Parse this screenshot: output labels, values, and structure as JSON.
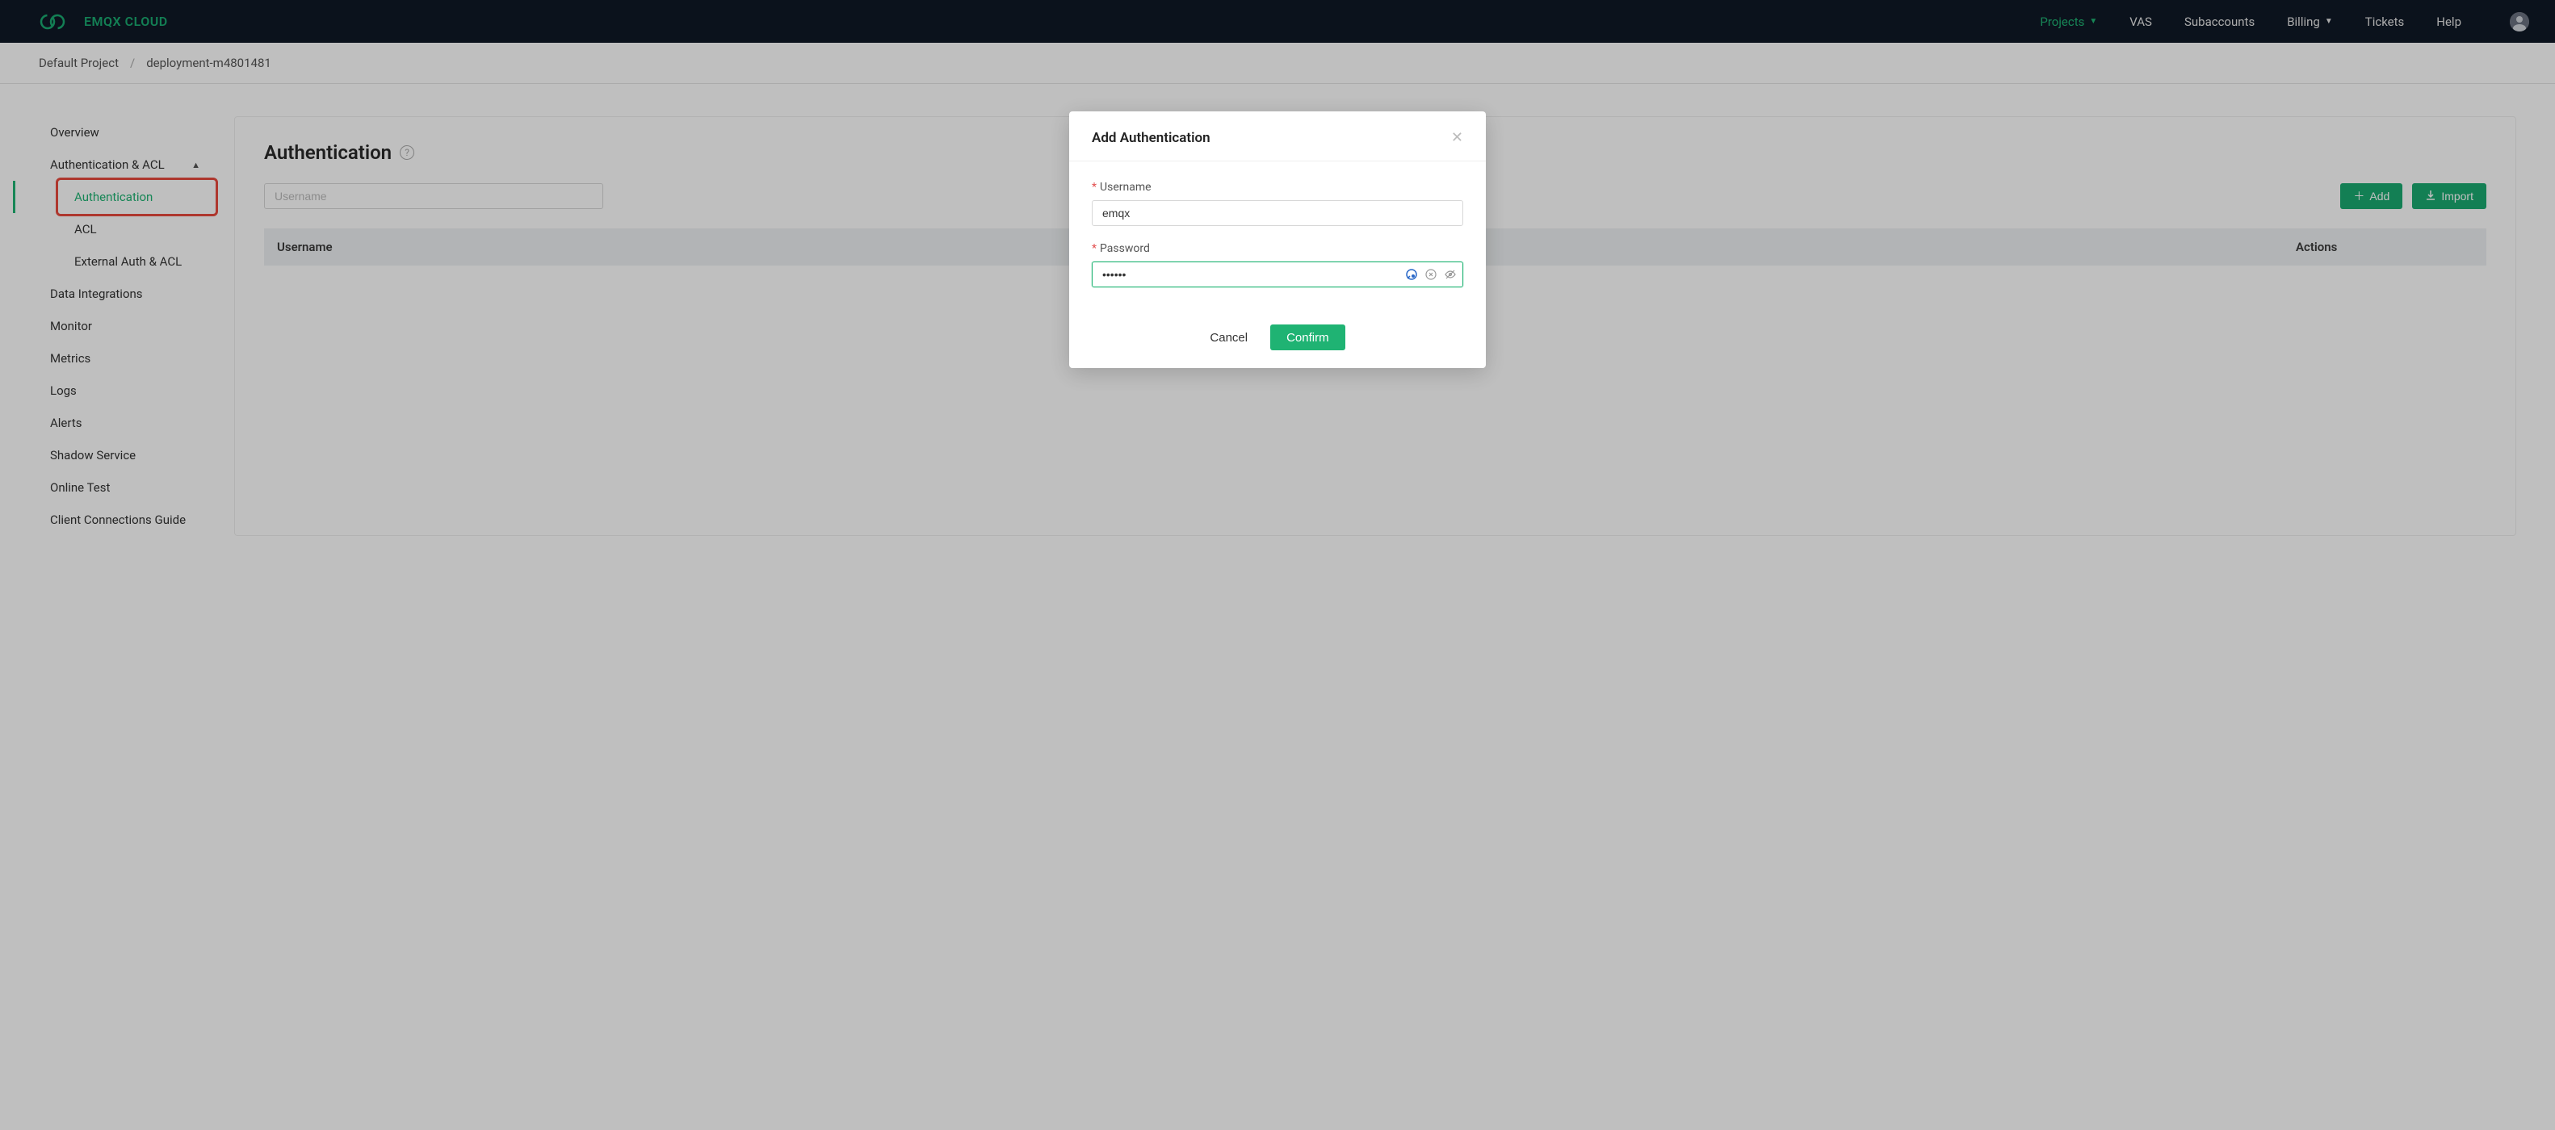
{
  "header": {
    "logo_text": "EMQX CLOUD",
    "nav": [
      {
        "label": "Projects",
        "active": true,
        "has_caret": true
      },
      {
        "label": "VAS"
      },
      {
        "label": "Subaccounts"
      },
      {
        "label": "Billing",
        "has_caret": true
      },
      {
        "label": "Tickets"
      },
      {
        "label": "Help"
      }
    ]
  },
  "breadcrumb": {
    "items": [
      "Default Project",
      "deployment-m4801481"
    ],
    "separator": "/"
  },
  "sidebar": {
    "items": [
      {
        "label": "Overview"
      },
      {
        "label": "Authentication & ACL",
        "expanded": true
      },
      {
        "label": "Authentication",
        "sub": true,
        "active": true,
        "highlighted": true
      },
      {
        "label": "ACL",
        "sub": true
      },
      {
        "label": "External Auth & ACL",
        "sub": true
      },
      {
        "label": "Data Integrations"
      },
      {
        "label": "Monitor"
      },
      {
        "label": "Metrics"
      },
      {
        "label": "Logs"
      },
      {
        "label": "Alerts"
      },
      {
        "label": "Shadow Service"
      },
      {
        "label": "Online Test"
      },
      {
        "label": "Client Connections Guide"
      }
    ]
  },
  "page": {
    "title": "Authentication",
    "search_placeholder": "Username",
    "add_button": "Add",
    "import_button": "Import",
    "table_headers": {
      "username": "Username",
      "actions": "Actions"
    }
  },
  "modal": {
    "title": "Add Authentication",
    "username_label": "Username",
    "username_value": "emqx",
    "password_label": "Password",
    "password_value": "••••••",
    "cancel": "Cancel",
    "confirm": "Confirm"
  }
}
